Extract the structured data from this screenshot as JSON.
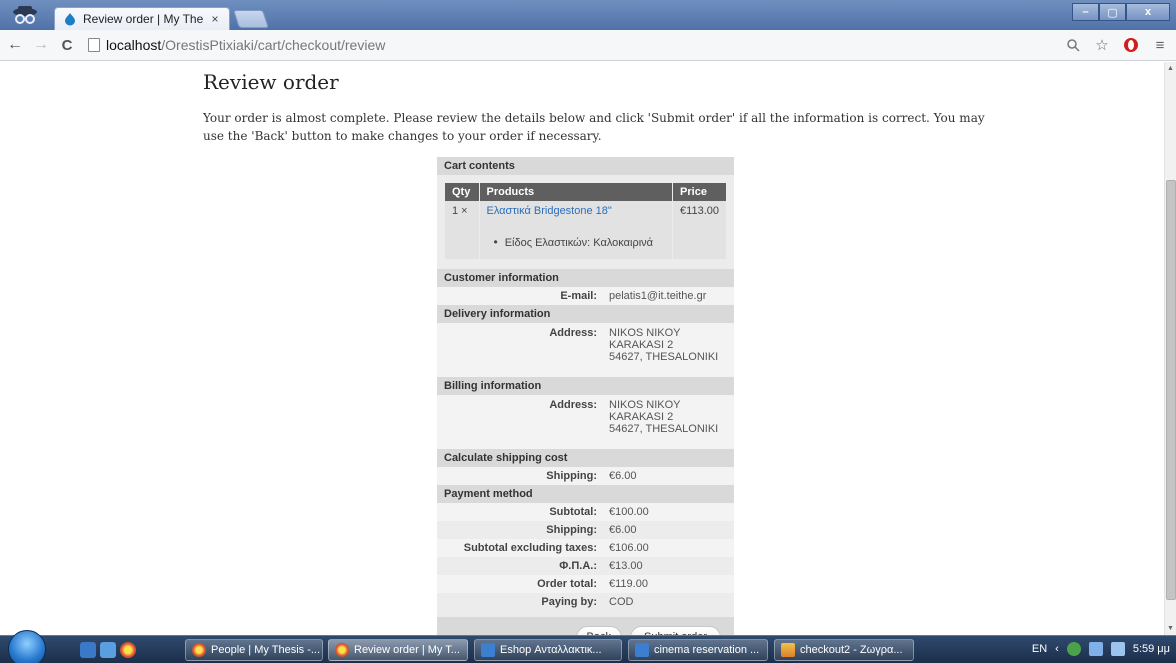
{
  "browser": {
    "tab_title": "Review order | My Thesis",
    "tab_close": "×",
    "url_host": "localhost",
    "url_path": "/OrestisPtixiaki/cart/checkout/review",
    "window_buttons": [
      "–",
      "▢",
      "x"
    ]
  },
  "page": {
    "title": "Review order",
    "intro": "Your order is almost complete. Please review the details below and click 'Submit order' if all the information is correct. You may use the 'Back' button to make changes to your order if necessary."
  },
  "cart": {
    "header": "Cart contents",
    "columns": [
      "Qty",
      "Products",
      "Price"
    ],
    "item": {
      "qty": "1 ×",
      "product": "Ελαστικά Bridgestone 18\"",
      "attribute": "Είδος Ελαστικών: Καλοκαιρινά",
      "price": "€113.00"
    }
  },
  "customer": {
    "header": "Customer information",
    "email_label": "E-mail:",
    "email_value": "pelatis1@it.teithe.gr"
  },
  "delivery": {
    "header": "Delivery information",
    "address_label": "Address:",
    "line1": "NIKOS NIKOY",
    "line2": "KARAKASI 2",
    "line3": "54627, THESALONIKI"
  },
  "billing": {
    "header": "Billing information",
    "address_label": "Address:",
    "line1": "NIKOS NIKOY",
    "line2": "KARAKASI 2",
    "line3": "54627, THESALONIKI"
  },
  "shipping": {
    "header": "Calculate shipping cost",
    "label": "Shipping:",
    "value": "€6.00"
  },
  "payment": {
    "header": "Payment method",
    "rows": [
      {
        "label": "Subtotal:",
        "value": "€100.00"
      },
      {
        "label": "Shipping:",
        "value": "€6.00"
      },
      {
        "label": "Subtotal excluding taxes:",
        "value": "€106.00"
      },
      {
        "label": "Φ.Π.Α.:",
        "value": "€13.00"
      },
      {
        "label": "Order total:",
        "value": "€119.00"
      },
      {
        "label": "Paying by:",
        "value": "COD"
      }
    ]
  },
  "buttons": {
    "back": "Back",
    "submit": "Submit order"
  },
  "taskbar": {
    "tasks": [
      "People | My Thesis -...",
      "Review order | My T...",
      "Eshop Ανταλλακτικ...",
      "cinema reservation ...",
      "checkout2 - Ζωγρα..."
    ],
    "language": "EN",
    "clock": "5:59 μμ"
  },
  "colors": {
    "link": "#2a6ebb",
    "section_header": "#d9d9d9",
    "table_header": "#5f5f5f",
    "panel": "#ececec"
  }
}
